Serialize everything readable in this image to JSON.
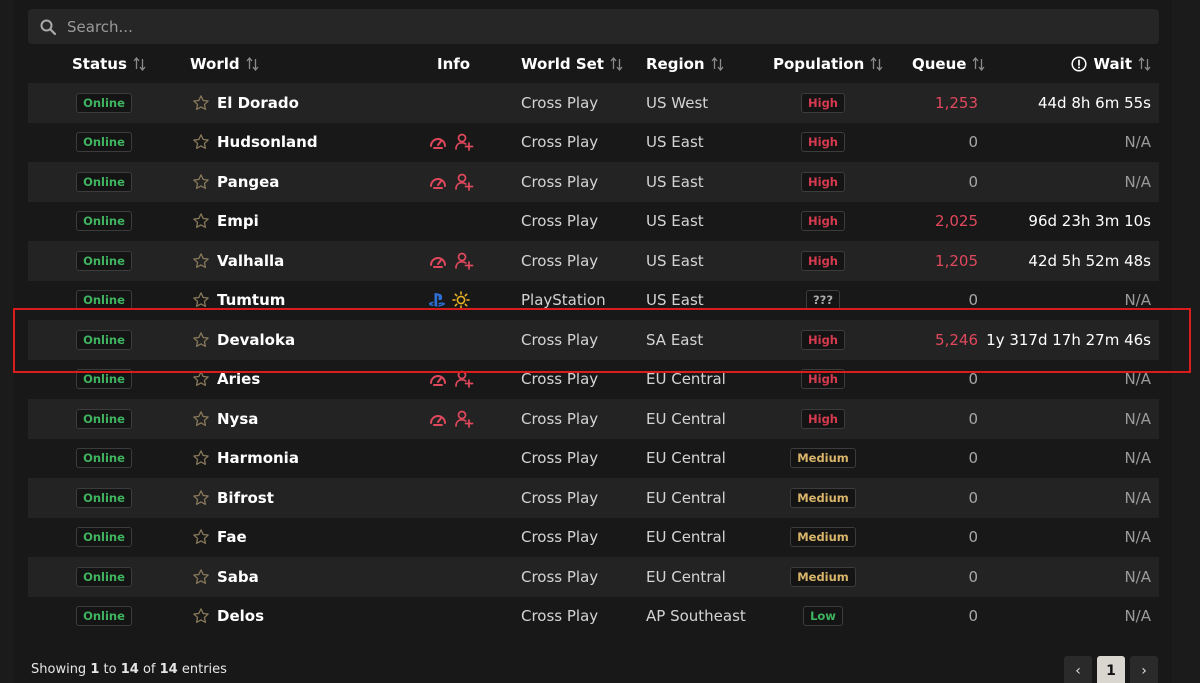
{
  "search": {
    "placeholder": "Search..."
  },
  "columns": {
    "status": "Status",
    "world": "World",
    "info": "Info",
    "world_set": "World Set",
    "region": "Region",
    "population": "Population",
    "queue": "Queue",
    "wait": "Wait"
  },
  "rows": [
    {
      "status": "Online",
      "world": "El Dorado",
      "info": [],
      "world_set": "Cross Play",
      "region": "US West",
      "population": "High",
      "queue": "1,253",
      "wait": "44d 8h 6m 55s"
    },
    {
      "status": "Online",
      "world": "Hudsonland",
      "info": [
        "speed",
        "user-plus"
      ],
      "world_set": "Cross Play",
      "region": "US East",
      "population": "High",
      "queue": "0",
      "wait": "N/A"
    },
    {
      "status": "Online",
      "world": "Pangea",
      "info": [
        "speed",
        "user-plus"
      ],
      "world_set": "Cross Play",
      "region": "US East",
      "population": "High",
      "queue": "0",
      "wait": "N/A"
    },
    {
      "status": "Online",
      "world": "Empi",
      "info": [],
      "world_set": "Cross Play",
      "region": "US East",
      "population": "High",
      "queue": "2,025",
      "wait": "96d 23h 3m 10s"
    },
    {
      "status": "Online",
      "world": "Valhalla",
      "info": [
        "speed",
        "user-plus"
      ],
      "world_set": "Cross Play",
      "region": "US East",
      "population": "High",
      "queue": "1,205",
      "wait": "42d 5h 52m 48s"
    },
    {
      "status": "Online",
      "world": "Tumtum",
      "info": [
        "playstation",
        "sun"
      ],
      "world_set": "PlayStation",
      "region": "US East",
      "population": "???",
      "queue": "0",
      "wait": "N/A"
    },
    {
      "status": "Online",
      "world": "Devaloka",
      "info": [],
      "world_set": "Cross Play",
      "region": "SA East",
      "population": "High",
      "queue": "5,246",
      "wait": "1y 317d 17h 27m 46s"
    },
    {
      "status": "Online",
      "world": "Aries",
      "info": [
        "speed",
        "user-plus"
      ],
      "world_set": "Cross Play",
      "region": "EU Central",
      "population": "High",
      "queue": "0",
      "wait": "N/A"
    },
    {
      "status": "Online",
      "world": "Nysa",
      "info": [
        "speed",
        "user-plus"
      ],
      "world_set": "Cross Play",
      "region": "EU Central",
      "population": "High",
      "queue": "0",
      "wait": "N/A"
    },
    {
      "status": "Online",
      "world": "Harmonia",
      "info": [],
      "world_set": "Cross Play",
      "region": "EU Central",
      "population": "Medium",
      "queue": "0",
      "wait": "N/A"
    },
    {
      "status": "Online",
      "world": "Bifrost",
      "info": [],
      "world_set": "Cross Play",
      "region": "EU Central",
      "population": "Medium",
      "queue": "0",
      "wait": "N/A"
    },
    {
      "status": "Online",
      "world": "Fae",
      "info": [],
      "world_set": "Cross Play",
      "region": "EU Central",
      "population": "Medium",
      "queue": "0",
      "wait": "N/A"
    },
    {
      "status": "Online",
      "world": "Saba",
      "info": [],
      "world_set": "Cross Play",
      "region": "EU Central",
      "population": "Medium",
      "queue": "0",
      "wait": "N/A"
    },
    {
      "status": "Online",
      "world": "Delos",
      "info": [],
      "world_set": "Cross Play",
      "region": "AP Southeast",
      "population": "Low",
      "queue": "0",
      "wait": "N/A"
    }
  ],
  "footer": {
    "prefix": "Showing",
    "from": "1",
    "to_word": "to",
    "to": "14",
    "of_word": "of",
    "total": "14",
    "suffix": "entries"
  },
  "pagination": {
    "prev": "‹",
    "current": "1",
    "next": "›"
  },
  "colors": {
    "accent_red": "#e0485c",
    "online_green": "#3fb35f",
    "medium_gold": "#d8b56a",
    "highlight": "#d91d1d"
  }
}
